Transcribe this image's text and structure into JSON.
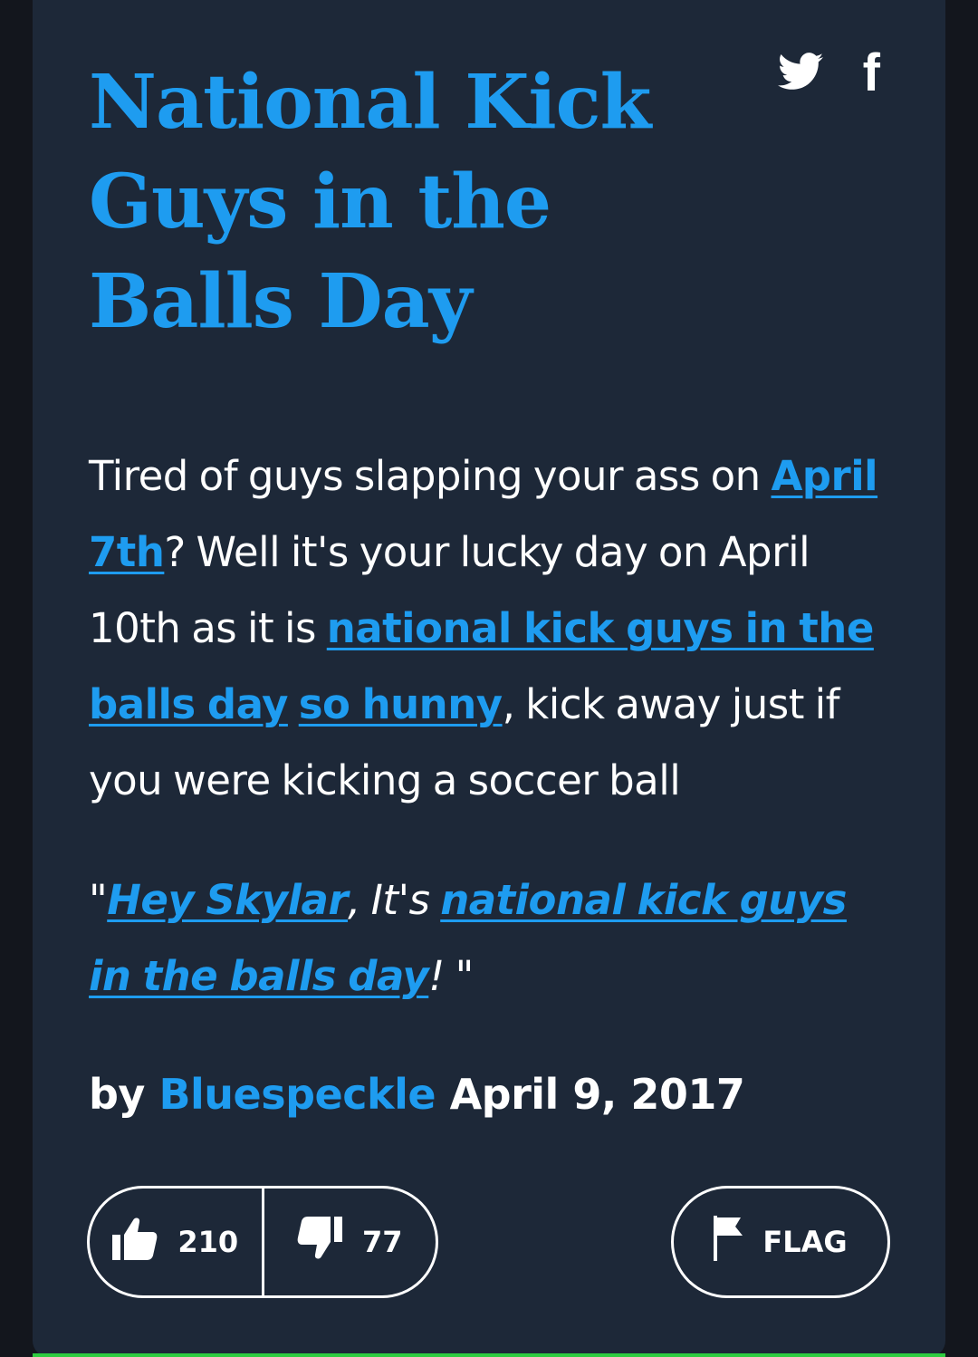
{
  "entry": {
    "title": "National Kick Guys in the Balls Day",
    "share": {
      "twitter_icon": "twitter-bird-icon",
      "facebook_label": "f"
    },
    "meaning": {
      "t1": "Tired of guys slapping your ass on ",
      "l1": "April 7th",
      "t2": "? Well it's your lucky day on April 10th as it is ",
      "l2": "national kick guys in the balls day",
      "t3": " ",
      "l3": "so hunny",
      "t4": ", kick away just if you were kicking a soccer ball"
    },
    "example": {
      "t1": "\"",
      "l1": "Hey Skylar",
      "t2": ", It's ",
      "l2": "national kick guys in the balls day",
      "t3": "! \""
    },
    "byline": {
      "by": "by",
      "author": "Bluespeckle",
      "date": "April 9, 2017"
    },
    "votes": {
      "up_count": "210",
      "down_count": "77"
    },
    "flag_label": "FLAG"
  },
  "colors": {
    "background": "#13161d",
    "card": "#1d2838",
    "accent": "#1e9cf0",
    "text": "#ffffff",
    "bottom_rule": "#2ecc40"
  }
}
